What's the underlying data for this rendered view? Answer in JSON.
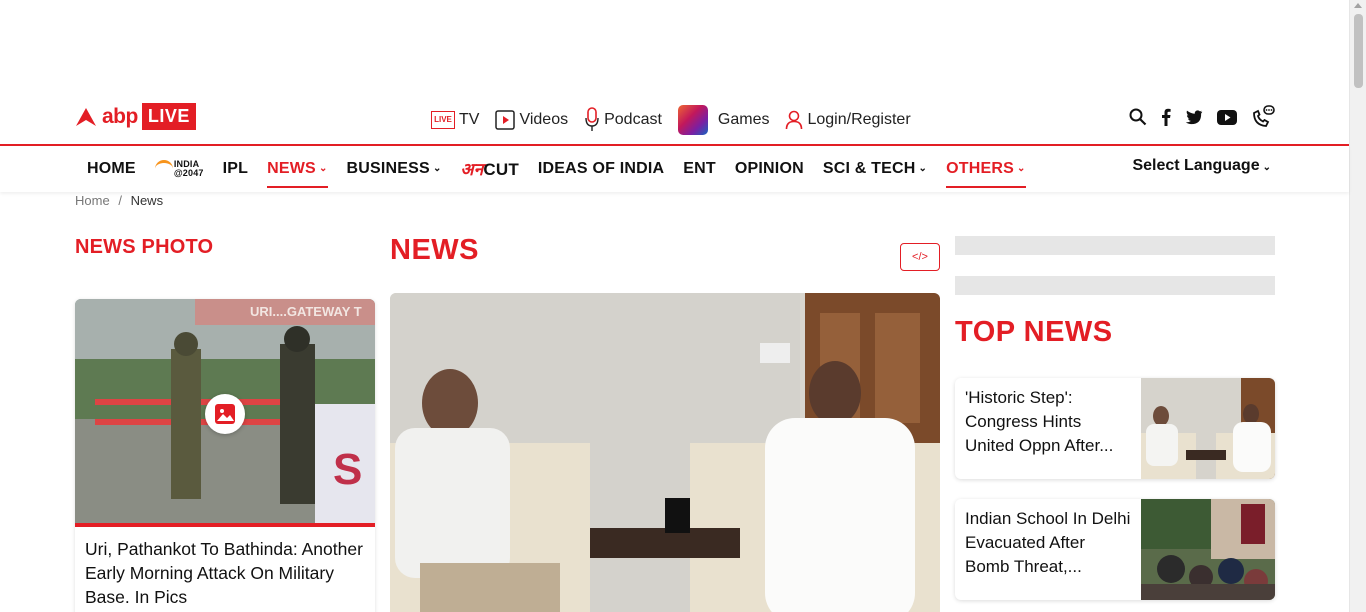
{
  "brand": {
    "name": "abp",
    "badge": "LIVE"
  },
  "utility": {
    "tv": "TV",
    "tv_icon_text": "LIVE",
    "videos": "Videos",
    "podcast": "Podcast",
    "games": "Games",
    "login": "Login/Register"
  },
  "nav": {
    "home": "HOME",
    "india2047_line1": "INDIA",
    "india2047_line2": "@2047",
    "ipl": "IPL",
    "news": "NEWS",
    "business": "BUSINESS",
    "anucut_a": "अन",
    "anucut_b": "CUT",
    "ideas": "IDEAS OF INDIA",
    "ent": "ENT",
    "opinion": "OPINION",
    "scitech": "SCI & TECH",
    "others": "OTHERS",
    "language": "Select Language"
  },
  "breadcrumb": {
    "home": "Home",
    "sep": "/",
    "current": "News"
  },
  "left": {
    "section_title": "NEWS PHOTO",
    "photo_caption": "Uri, Pathankot To Bathinda: Another Early Morning Attack On Military Base. In Pics",
    "sign_text": "URI....GATEWAY T"
  },
  "main": {
    "section_title": "NEWS",
    "embed_label": "</>"
  },
  "right": {
    "section_title": "TOP NEWS",
    "cards": [
      {
        "text": "'Historic Step': Congress Hints United Oppn After..."
      },
      {
        "text": "Indian School In Delhi Evacuated After Bomb Threat,..."
      }
    ]
  },
  "colors": {
    "accent": "#e31e25",
    "skeleton": "#e6e6e6"
  }
}
